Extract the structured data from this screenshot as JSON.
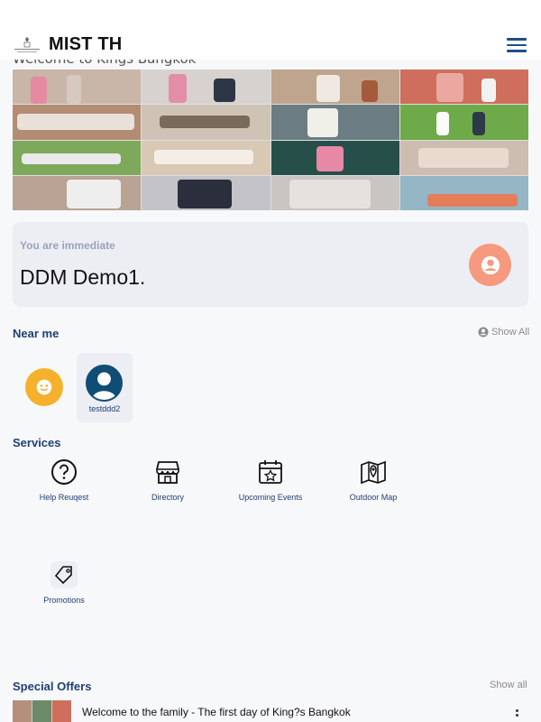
{
  "header": {
    "title": "MIST TH",
    "welcome": "Welcome to Kings Bangkok"
  },
  "user_card": {
    "label": "You are immediate",
    "name": "DDM Demo1."
  },
  "near_me": {
    "title": "Near me",
    "show_all": "Show All",
    "people": [
      {
        "name": "testddd2"
      }
    ]
  },
  "services": {
    "title": "Services",
    "items": [
      {
        "label": "Help Reuqest",
        "icon": "help-icon"
      },
      {
        "label": "Directory",
        "icon": "store-icon"
      },
      {
        "label": "Upcoming Events",
        "icon": "calendar-star-icon"
      },
      {
        "label": "Outdoor Map",
        "icon": "map-pin-icon"
      },
      {
        "label": "Promotions",
        "icon": "tag-icon"
      }
    ]
  },
  "special_offers": {
    "title": "Special Offers",
    "show_all": "Show all",
    "items": [
      {
        "title": "Welcome to the family - The first day of King?s Bangkok"
      }
    ]
  },
  "colors": {
    "accent": "#1f3f73",
    "avatar_orange": "#f59a7f",
    "emoji_yellow": "#f5b12c",
    "card_bg": "#eceef3"
  }
}
